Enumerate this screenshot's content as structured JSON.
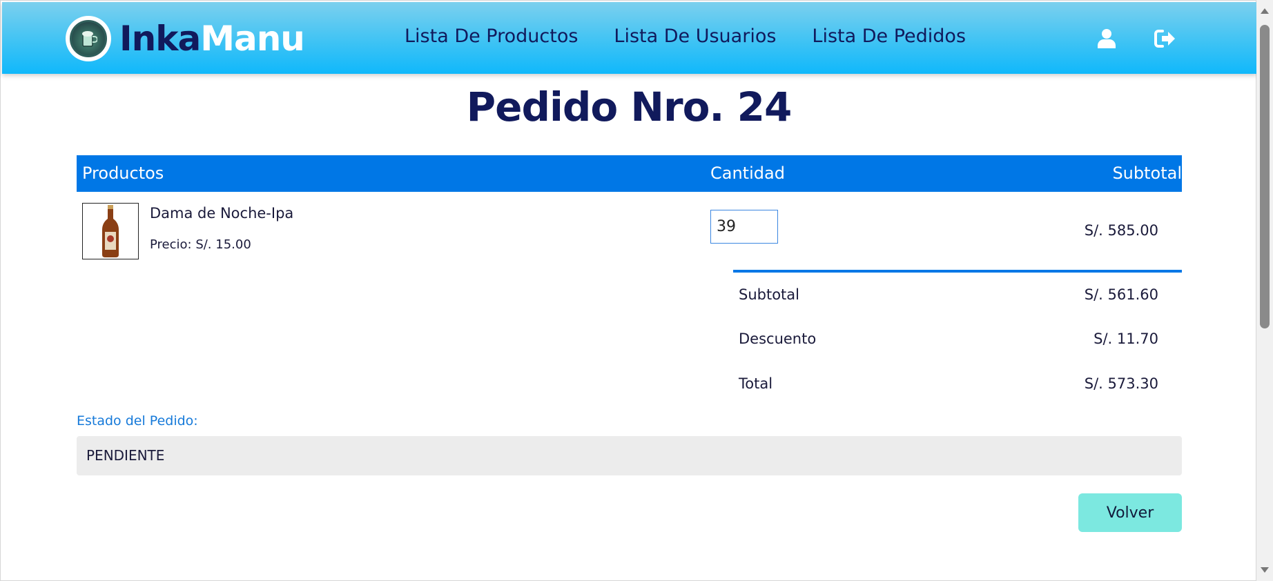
{
  "header": {
    "brand_part1": "Inka",
    "brand_part2": "Manu",
    "nav": [
      "Lista De Productos",
      "Lista De Usuarios",
      "Lista De Pedidos"
    ],
    "icons": [
      "user-icon",
      "logout-icon"
    ]
  },
  "page": {
    "title": "Pedido Nro. 24"
  },
  "table": {
    "headers": {
      "products": "Productos",
      "quantity": "Cantidad",
      "subtotal": "Subtotal"
    },
    "rows": [
      {
        "name": "Dama de Noche-Ipa",
        "price": "Precio: S/. 15.00",
        "quantity": "39",
        "subtotal": "S/. 585.00"
      }
    ]
  },
  "summary": {
    "subtotal_label": "Subtotal",
    "subtotal_value": "S/. 561.60",
    "discount_label": "Descuento",
    "discount_value": "S/. 11.70",
    "total_label": "Total",
    "total_value": "S/. 573.30"
  },
  "status": {
    "label": "Estado del Pedido:",
    "value": "PENDIENTE"
  },
  "actions": {
    "back_label": "Volver"
  },
  "colors": {
    "header_gradient_top": "#7cd0ee",
    "header_gradient_bottom": "#10b8fb",
    "navy": "#111a5c",
    "table_header": "#0077e6",
    "title_underline": "#40e0cc",
    "back_button": "#7ce8e0",
    "status_box": "#ececec"
  }
}
